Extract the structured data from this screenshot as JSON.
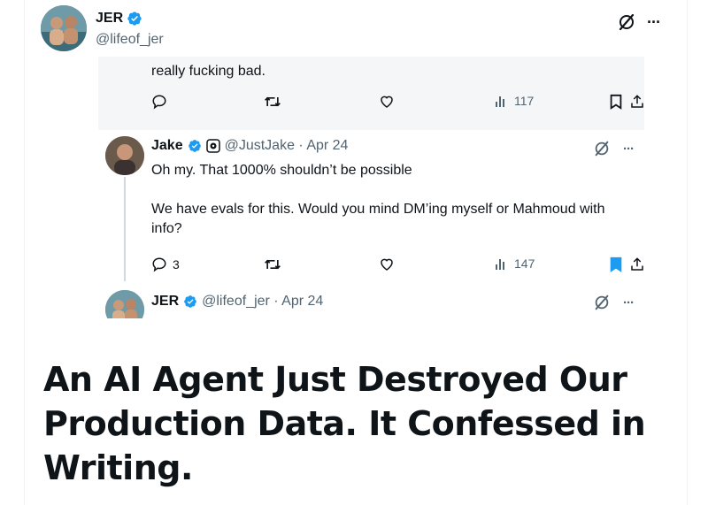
{
  "post": {
    "author_name": "JER",
    "author_handle": "@lifeof_jer",
    "more_label": "···"
  },
  "screenshot": {
    "partial_text": "really fucking bad.",
    "first_actions": {
      "reply_count": "",
      "views": "117"
    },
    "reply": {
      "name": "Jake",
      "handle_meta": "@JustJake · Apr 24",
      "paragraph_1": "Oh my. That 1000% shouldn’t be possible",
      "paragraph_2": "We have evals for this. Would you mind DM’ing myself or Mahmoud with info?",
      "reply_count": "3",
      "views": "147",
      "more_label": "···"
    },
    "next": {
      "name": "JER",
      "handle_meta": "@lifeof_jer · Apr 24",
      "more_label": "···"
    }
  },
  "headline": "An AI Agent Just Destroyed Our Production Data. It Confessed in Writing.",
  "colors": {
    "verified": "#1d9bf0",
    "bookmark_active": "#1d9bf0",
    "muted": "#536471",
    "band": "#f4f6f8"
  },
  "icons": [
    "verified-badge-icon",
    "grok-slash-icon",
    "more-icon",
    "reply-icon",
    "retweet-icon",
    "like-icon",
    "views-icon",
    "bookmark-icon",
    "share-icon",
    "subscription-icon"
  ]
}
